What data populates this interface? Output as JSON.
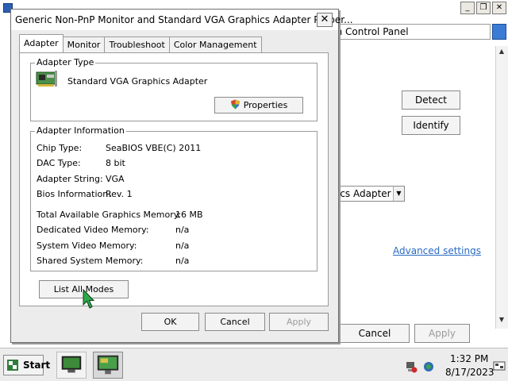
{
  "background_window": {
    "address_text": "ch Control Panel",
    "detect_label": "Detect",
    "identify_label": "Identify",
    "display_combo_value": "ics Adapter",
    "advanced_link": "Advanced settings",
    "cancel_label": "Cancel",
    "apply_label": "Apply",
    "window_buttons": {
      "minimize": "_",
      "restore": "❐",
      "close": "✕"
    }
  },
  "dialog": {
    "title": "Generic Non-PnP Monitor and Standard VGA Graphics Adapter Proper...",
    "close_glyph": "✕",
    "tabs": [
      {
        "label": "Adapter",
        "active": true
      },
      {
        "label": "Monitor",
        "active": false
      },
      {
        "label": "Troubleshoot",
        "active": false
      },
      {
        "label": "Color Management",
        "active": false
      }
    ],
    "adapter_type": {
      "legend": "Adapter Type",
      "name": "Standard VGA Graphics Adapter",
      "properties_label": "Properties"
    },
    "adapter_info": {
      "legend": "Adapter Information",
      "rows": [
        {
          "label": "Chip Type:",
          "value": "SeaBIOS VBE(C) 2011"
        },
        {
          "label": "DAC Type:",
          "value": "8 bit"
        },
        {
          "label": "Adapter String:",
          "value": "VGA"
        },
        {
          "label": "Bios Information:",
          "value": "Rev. 1"
        }
      ],
      "memory_rows": [
        {
          "label": "Total Available Graphics Memory:",
          "value": "16 MB"
        },
        {
          "label": "Dedicated Video Memory:",
          "value": "n/a"
        },
        {
          "label": "System Video Memory:",
          "value": "n/a"
        },
        {
          "label": "Shared System Memory:",
          "value": "n/a"
        }
      ]
    },
    "list_all_modes_label": "List All Modes",
    "ok_label": "OK",
    "cancel_label": "Cancel",
    "apply_label": "Apply"
  },
  "taskbar": {
    "start_label": "Start",
    "clock_time": "1:32 PM",
    "clock_date": "8/17/2023"
  }
}
